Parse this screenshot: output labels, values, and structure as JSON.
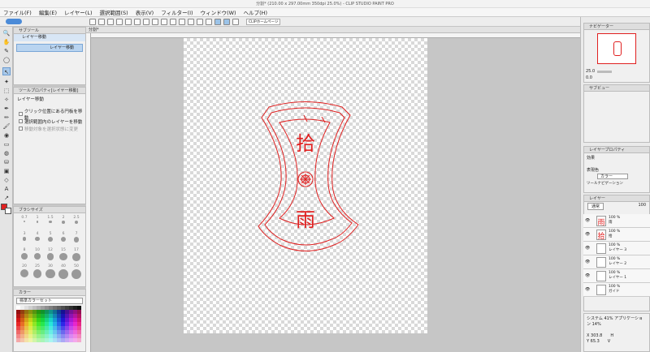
{
  "window": {
    "title": "分割* (210.00 x 297.00mm 350dpi 25.0%) - CLIP STUDIO PAINT PRO"
  },
  "menu": [
    "ファイル(F)",
    "編集(E)",
    "レイヤー(L)",
    "選択範囲(S)",
    "表示(V)",
    "フィルター(I)",
    "ウィンドウ(W)",
    "ヘルプ(H)"
  ],
  "toolbar": {
    "tab": "CLIPホームページ"
  },
  "subtool": {
    "title": "サブツール",
    "active_tool": "レイヤー移動",
    "item": "レイヤー移動"
  },
  "tool_property": {
    "title": "ツールプロパティ[レイヤー移動]",
    "name": "レイヤー移動",
    "options": [
      "クリック位置にある円板を移動",
      "選択範囲内のレイヤーを移動",
      "移動対象を選択状態に変更"
    ]
  },
  "brush_size": {
    "title": "ブラシサイズ",
    "sizes": [
      "0.7",
      "1",
      "1.5",
      "2",
      "2.5",
      "3",
      "4",
      "5",
      "6",
      "7",
      "8",
      "10",
      "12",
      "15",
      "17",
      "20",
      "25",
      "30",
      "40",
      "50"
    ]
  },
  "color_set": {
    "title": "カラー",
    "set_name": "標準カラーセット"
  },
  "document": {
    "tab": "分割*"
  },
  "navigator": {
    "title": "ナビゲーター",
    "zoom": "25.0",
    "angle": "0.0"
  },
  "subview": {
    "title": "サブビュー"
  },
  "layer_property": {
    "title": "レイヤープロパティ",
    "effect": "効果",
    "expression_color": "表現色",
    "color_mode": "カラー",
    "tool_nav": "ツールナビゲーション"
  },
  "layer_panel": {
    "title": "レイヤー",
    "blend": "通常",
    "opacity": "100",
    "layers": [
      {
        "opacity": "100 %",
        "blend": "通常",
        "name": "雨"
      },
      {
        "opacity": "100 %",
        "blend": "通常",
        "name": "拾"
      },
      {
        "opacity": "100 %",
        "blend": "通常",
        "name": "レイヤー 3"
      },
      {
        "opacity": "100 %",
        "blend": "通常",
        "name": "レイヤー 2"
      },
      {
        "opacity": "100 %",
        "blend": "通常",
        "name": "レイヤー 1"
      },
      {
        "opacity": "100 %",
        "blend": "通常",
        "name": "ガイド"
      }
    ]
  },
  "info": {
    "system": "システム 41%",
    "app": "アプリケーション 14%",
    "x": "X 303.8",
    "y": "Y 65.3",
    "h": "H",
    "v": "V"
  },
  "artwork": {
    "char_top": "拾",
    "char_bottom": "雨",
    "line_color": "#e02020"
  }
}
